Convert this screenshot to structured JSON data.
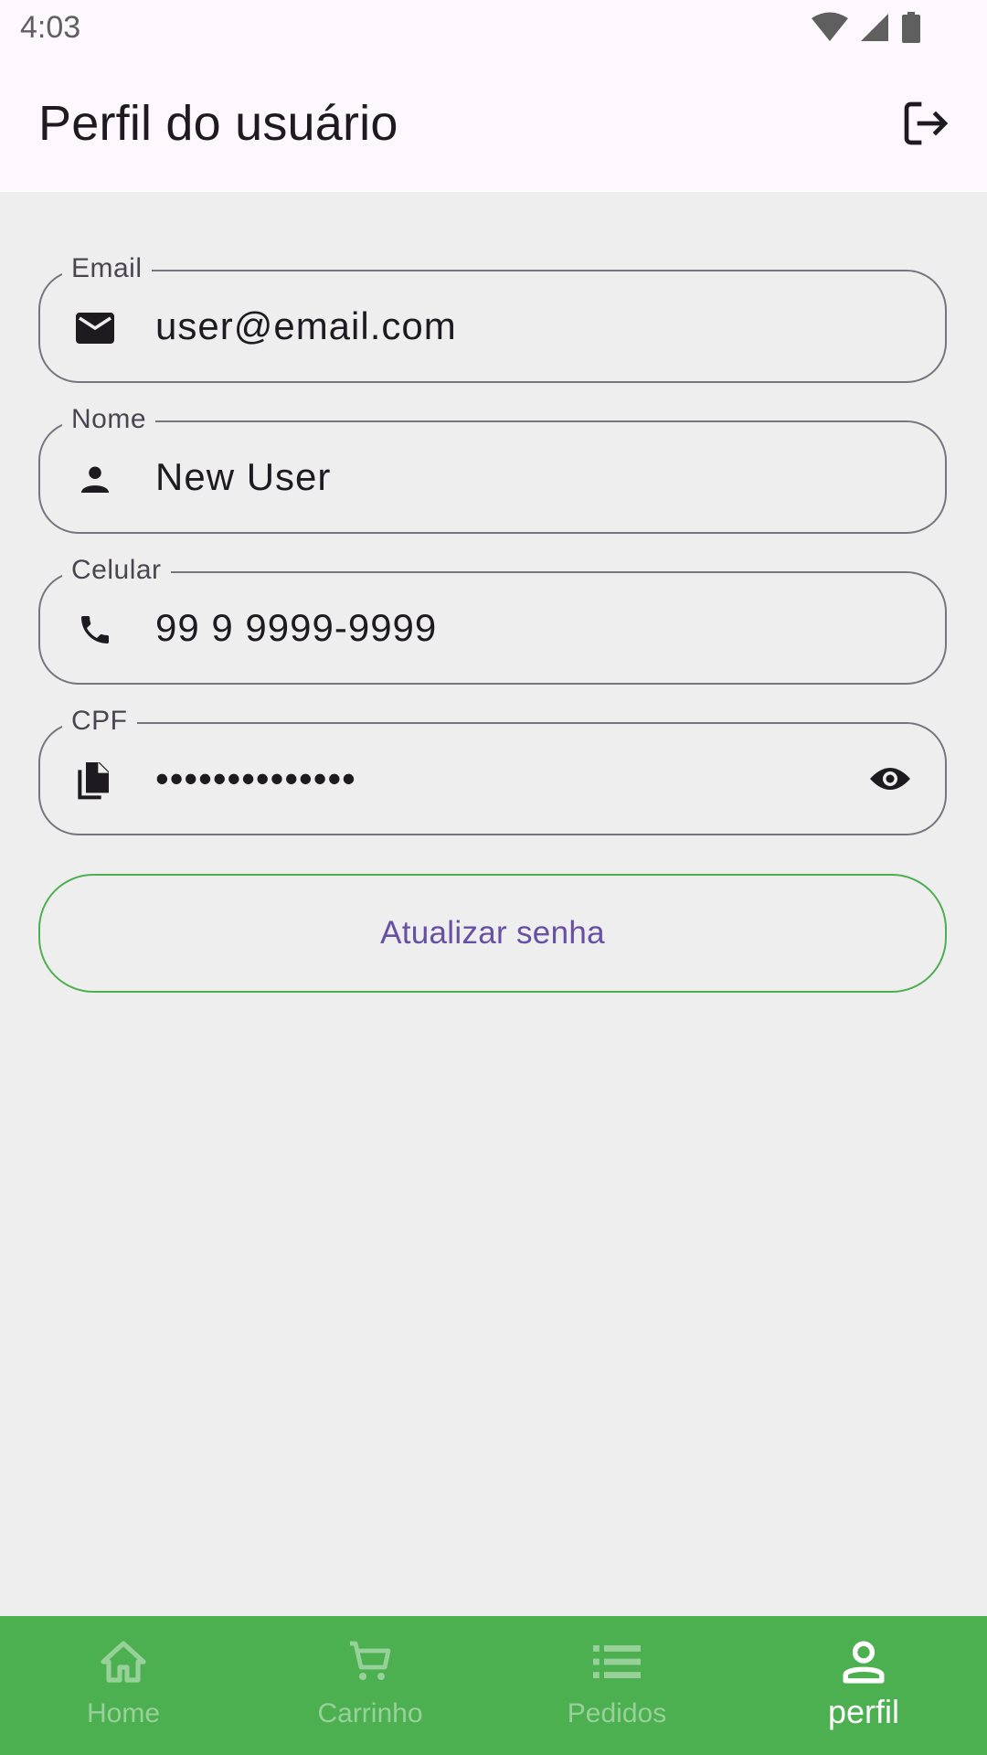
{
  "status_bar": {
    "time": "4:03"
  },
  "app_bar": {
    "title": "Perfil do usuário"
  },
  "form": {
    "email": {
      "label": "Email",
      "value": "user@email.com"
    },
    "name": {
      "label": "Nome",
      "value": "New User"
    },
    "phone": {
      "label": "Celular",
      "value": "99 9 9999-9999"
    },
    "cpf": {
      "label": "CPF",
      "value": "••••••••••••••"
    }
  },
  "update_password_label": "Atualizar senha",
  "bottom_nav": {
    "items": [
      {
        "label": "Home",
        "icon": "home-icon"
      },
      {
        "label": "Carrinho",
        "icon": "cart-icon"
      },
      {
        "label": "Pedidos",
        "icon": "list-icon"
      },
      {
        "label": "perfil",
        "icon": "person-icon"
      }
    ],
    "active_index": 3
  },
  "colors": {
    "app_bar_bg": "#fdf7fe",
    "content_bg": "#eeeeee",
    "accent_green": "#4caf50",
    "button_text": "#6750a4",
    "outline": "#79747e"
  }
}
